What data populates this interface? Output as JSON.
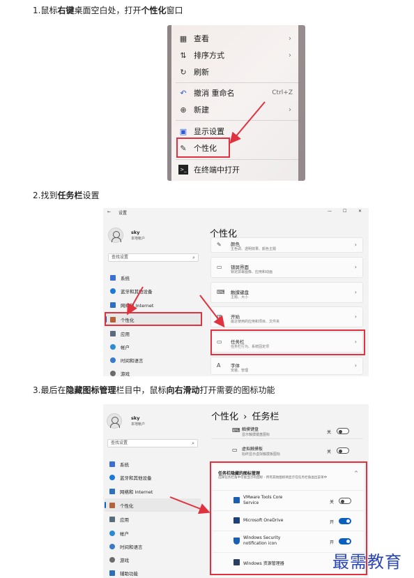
{
  "steps": {
    "s1": {
      "num": "1.",
      "a": "鼠标",
      "b": "右键",
      "c": "桌面空白处，打开",
      "d": "个性化",
      "e": "窗口"
    },
    "s2": {
      "num": "2.",
      "a": "找到",
      "b": "任务栏",
      "c": "设置"
    },
    "s3": {
      "num": "3.",
      "a": "最后在",
      "b": "隐藏图标管理",
      "c": "栏目中，鼠标",
      "d": "向右滑动",
      "e": "打开需要的图标功能"
    }
  },
  "context_menu": {
    "items": [
      {
        "label": "查看",
        "icon": "grid-icon",
        "chevron": "›"
      },
      {
        "label": "排序方式",
        "icon": "sort-icon",
        "chevron": "›"
      },
      {
        "label": "刷新",
        "icon": "refresh-icon"
      },
      {
        "label": "撤消 重命名",
        "icon": "undo-icon",
        "shortcut": "Ctrl+Z"
      },
      {
        "label": "新建",
        "icon": "plus-circle-icon",
        "chevron": "›"
      },
      {
        "label": "显示设置",
        "icon": "display-icon"
      },
      {
        "label": "个性化",
        "icon": "brush-icon"
      },
      {
        "label": "在终端中打开",
        "icon": "terminal-icon"
      }
    ]
  },
  "settings1": {
    "title_bar": {
      "back": "←",
      "app": "设置",
      "min": "—",
      "max": "☐",
      "close": "✕"
    },
    "user": {
      "name": "sky",
      "account": "本地帐户"
    },
    "search_placeholder": "查找设置",
    "nav": [
      {
        "label": "系统",
        "color": "#3b6fd4"
      },
      {
        "label": "蓝牙和其他设备",
        "color": "#1d78d6"
      },
      {
        "label": "网络和 Internet",
        "color": "#2f6fbf"
      },
      {
        "label": "个性化",
        "color": "#b4623a"
      },
      {
        "label": "应用",
        "color": "#5a6b7d"
      },
      {
        "label": "帐户",
        "color": "#2f8bd1"
      },
      {
        "label": "时间和语言",
        "color": "#3a7bc8"
      },
      {
        "label": "游戏",
        "color": "#6b6b6b"
      }
    ],
    "heading": "个性化",
    "cards": [
      {
        "title": "颜色",
        "sub": "主色调、透明效果、颜色主题",
        "icon": "brush-icon"
      },
      {
        "title": "锁屏界面",
        "sub": "锁定屏幕图像、应用和动画",
        "icon": "lockscreen-icon"
      },
      {
        "title": "触摸键盘",
        "sub": "主题、大小",
        "icon": "keyboard-icon"
      },
      {
        "title": "开始",
        "sub": "最近使用的应用和项目、文件夹",
        "icon": "start-icon"
      },
      {
        "title": "任务栏",
        "sub": "任务栏行为、系统固定项",
        "icon": "taskbar-icon"
      },
      {
        "title": "字体",
        "sub": "安装、管理",
        "icon": "font-icon"
      }
    ]
  },
  "settings2": {
    "user": {
      "name": "sky",
      "account": "本地帐户"
    },
    "search_placeholder": "查找设置",
    "nav": [
      {
        "label": "系统",
        "color": "#3b6fd4"
      },
      {
        "label": "蓝牙和其他设备",
        "color": "#1d78d6"
      },
      {
        "label": "网络和 Internet",
        "color": "#2f6fbf"
      },
      {
        "label": "个性化",
        "color": "#b4623a"
      },
      {
        "label": "应用",
        "color": "#5a6b7d"
      },
      {
        "label": "帐户",
        "color": "#2f8bd1"
      },
      {
        "label": "时间和语言",
        "color": "#3a7bc8"
      },
      {
        "label": "游戏",
        "color": "#6b6b6b"
      },
      {
        "label": "辅助功能",
        "color": "#2a6fb8"
      }
    ],
    "breadcrumb": {
      "parent": "个性化",
      "sep": "›",
      "current": "任务栏"
    },
    "top_rows": [
      {
        "title": "触摸键盘",
        "sub": "显示触摸键盘图标",
        "state": "关",
        "on": false
      },
      {
        "title": "虚拟触摸板",
        "sub": "始终显示虚拟触摸板图标",
        "state": "关",
        "on": false
      }
    ],
    "section": {
      "title": "任务栏隐藏的图标管理",
      "desc": "选择任务栏角中可能显示的图标 - 所有其他图标将显示在任务栏角溢出菜单中",
      "chev": "^"
    },
    "icon_rows": [
      {
        "title": "VMware Tools Core",
        "title2": "Service",
        "state": "关",
        "on": false
      },
      {
        "title": "Microsoft OneDrive",
        "title2": "",
        "state": "开",
        "on": true
      },
      {
        "title": "Windows Security",
        "title2": "notification icon",
        "state": "开",
        "on": true
      },
      {
        "title": "Windows 资源管理器",
        "title2": "",
        "state": "",
        "on": false
      }
    ]
  },
  "watermark": "最需教育",
  "colors": {
    "highlight": "#e0323e",
    "toggle_on": "#0a5fbf",
    "watermark": "#2b47b8"
  }
}
